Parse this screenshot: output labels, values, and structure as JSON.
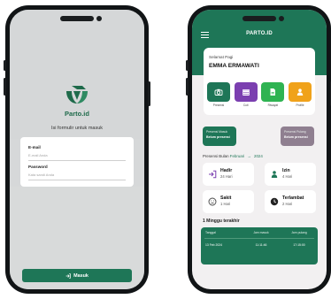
{
  "login": {
    "brand": "Parto.id",
    "subtitle": "Isi formulir untuk masuk",
    "email_label": "E-mail",
    "email_placeholder": "E-mail Anda",
    "password_label": "Password",
    "password_placeholder": "Kata sandi Anda",
    "submit_label": "Masuk"
  },
  "dashboard": {
    "app_title": "PARTO.ID",
    "greeting": "Selamat Pagi",
    "user_name": "EMMA ERMAWATI",
    "menu": [
      {
        "label": "Presensi",
        "icon": "camera-icon",
        "color": "#1e7657"
      },
      {
        "label": "Cuti",
        "icon": "calendar-icon",
        "color": "#7b3fb0"
      },
      {
        "label": "Riwayat",
        "icon": "document-icon",
        "color": "#2fb352"
      },
      {
        "label": "Profile",
        "icon": "person-icon",
        "color": "#f0a21a"
      }
    ],
    "presensi_masuk": {
      "title": "Presensi Masuk",
      "value": "Belum presensi",
      "color": "#1e7657"
    },
    "presensi_pulang": {
      "title": "Presensi Pulang",
      "value": "Belum presensi",
      "color": "#8f7f90"
    },
    "month_prefix": "Presensi Bulan",
    "month": "Februari",
    "year": "2024",
    "stats": [
      {
        "title": "Hadir",
        "value": "24 Hari",
        "icon": "login-icon",
        "color": "#7b3fb0"
      },
      {
        "title": "Izin",
        "value": "4 Hari",
        "icon": "person-icon",
        "color": "#1e7657"
      },
      {
        "title": "Sakit",
        "value": "1 Hari",
        "icon": "sad-face-icon",
        "color": "#444444"
      },
      {
        "title": "Terlambat",
        "value": "2 Hari",
        "icon": "clock-icon",
        "color": "#222222"
      }
    ],
    "week_title": "1 Minggu terakhir",
    "table": {
      "headers": [
        "Tanggal",
        "Jam masuk",
        "Jam pulang"
      ],
      "rows": [
        [
          "13 Feb 2024",
          "11:11:46",
          "17:15:00"
        ]
      ]
    }
  }
}
